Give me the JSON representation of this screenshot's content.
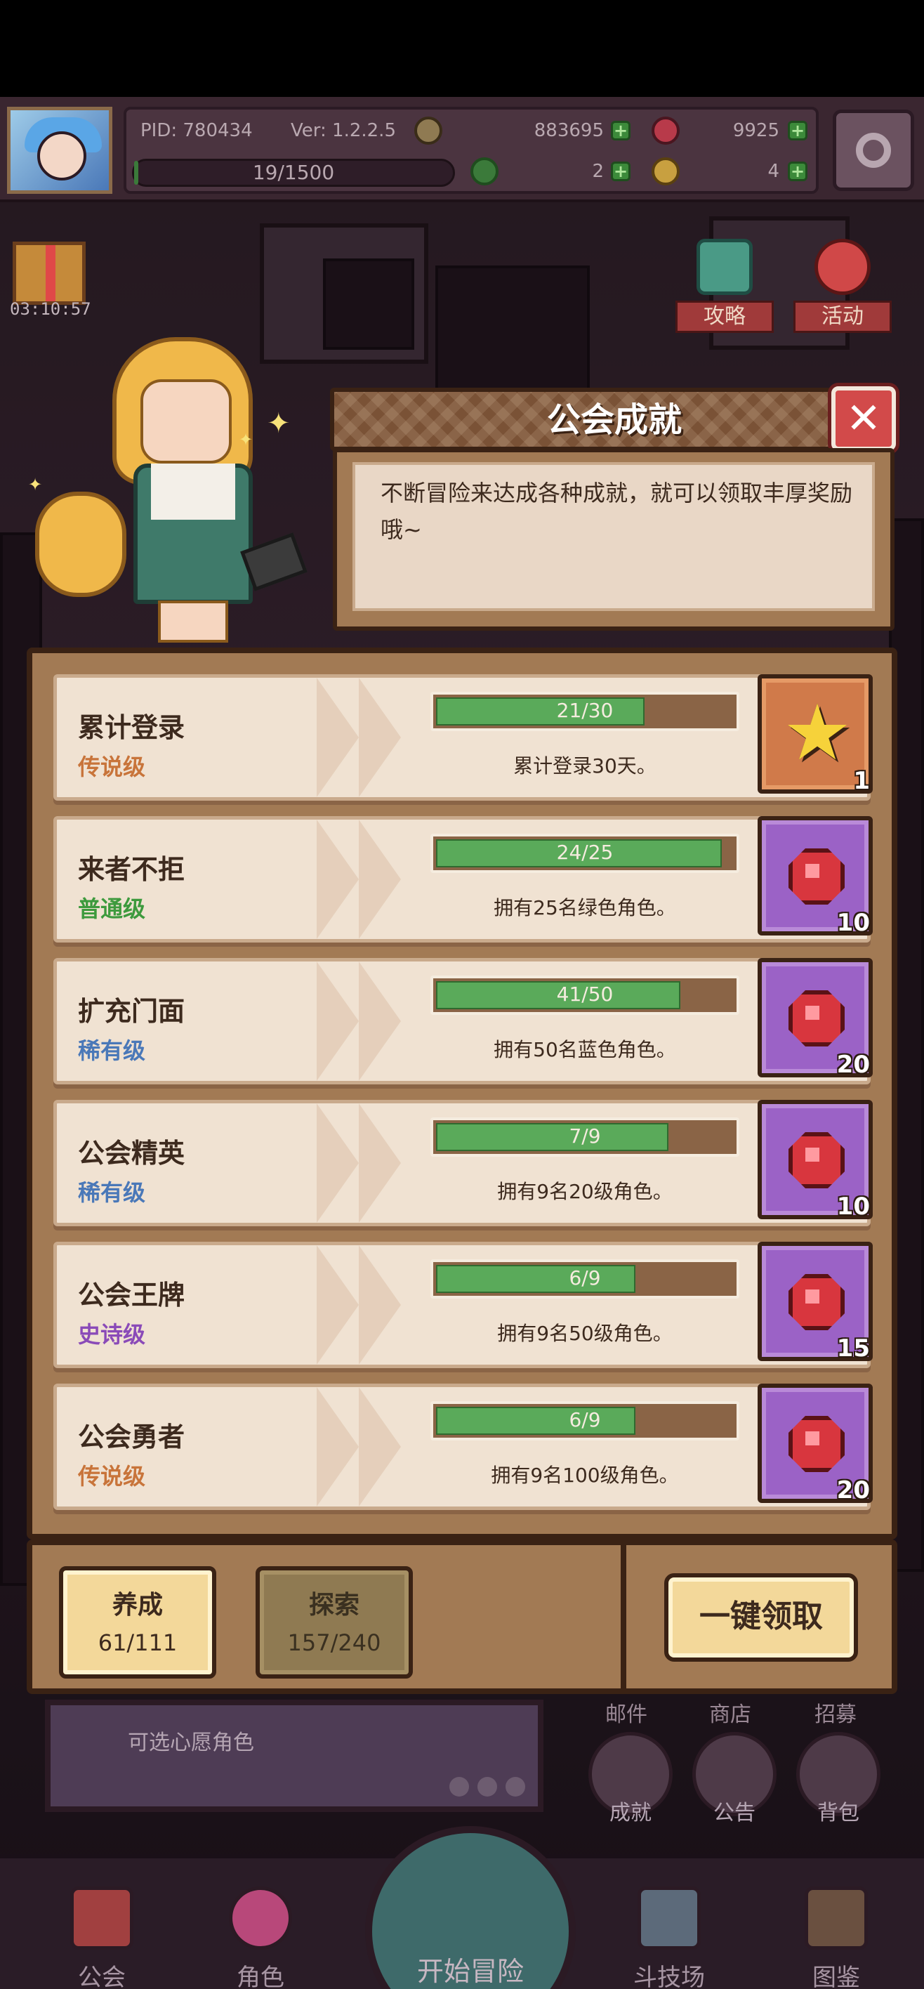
{
  "hud": {
    "pid": "PID: 780434",
    "version": "Ver: 1.2.2.5",
    "gold": "883695",
    "gems": "9925",
    "stamina": "19/1500",
    "stamina_fraction": 0.013,
    "clover_count": "2",
    "key_count": "4"
  },
  "gift_timer": "03:10:57",
  "top_buttons": {
    "guide": "攻略",
    "event": "活动"
  },
  "dialog": {
    "title": "公会成就",
    "description": "不断冒险来达成各种成就，就可以领取丰厚奖励哦~"
  },
  "achievements": [
    {
      "name": "累计登录",
      "rarity": "传说级",
      "rarity_color": "#c8743a",
      "progress": "21/30",
      "fraction": 0.7,
      "desc": "累计登录30天。",
      "reward_type": "star",
      "reward_count": "1"
    },
    {
      "name": "来者不拒",
      "rarity": "普通级",
      "rarity_color": "#3d9a3d",
      "progress": "24/25",
      "fraction": 0.96,
      "desc": "拥有25名绿色角色。",
      "reward_type": "gem",
      "reward_count": "10"
    },
    {
      "name": "扩充门面",
      "rarity": "稀有级",
      "rarity_color": "#4a78b8",
      "progress": "41/50",
      "fraction": 0.82,
      "desc": "拥有50名蓝色角色。",
      "reward_type": "gem",
      "reward_count": "20"
    },
    {
      "name": "公会精英",
      "rarity": "稀有级",
      "rarity_color": "#4a78b8",
      "progress": "7/9",
      "fraction": 0.78,
      "desc": "拥有9名20级角色。",
      "reward_type": "gem",
      "reward_count": "10"
    },
    {
      "name": "公会王牌",
      "rarity": "史诗级",
      "rarity_color": "#8a4ab8",
      "progress": "6/9",
      "fraction": 0.67,
      "desc": "拥有9名50级角色。",
      "reward_type": "gem",
      "reward_count": "15"
    },
    {
      "name": "公会勇者",
      "rarity": "传说级",
      "rarity_color": "#c8743a",
      "progress": "6/9",
      "fraction": 0.67,
      "desc": "拥有9名100级角色。",
      "reward_type": "gem",
      "reward_count": "20"
    }
  ],
  "tabs": [
    {
      "label": "养成",
      "count": "61/111",
      "active": true
    },
    {
      "label": "探索",
      "count": "157/240",
      "active": false
    }
  ],
  "claim_all": "一键领取",
  "background": {
    "banner_text": "可选心愿角色",
    "side_top_labels": [
      "邮件",
      "商店",
      "招募"
    ],
    "side_buttons": [
      "成就",
      "公告",
      "背包"
    ]
  },
  "nav": {
    "items": [
      "公会",
      "角色",
      "斗技场",
      "图鉴"
    ],
    "center": "开始冒险"
  }
}
